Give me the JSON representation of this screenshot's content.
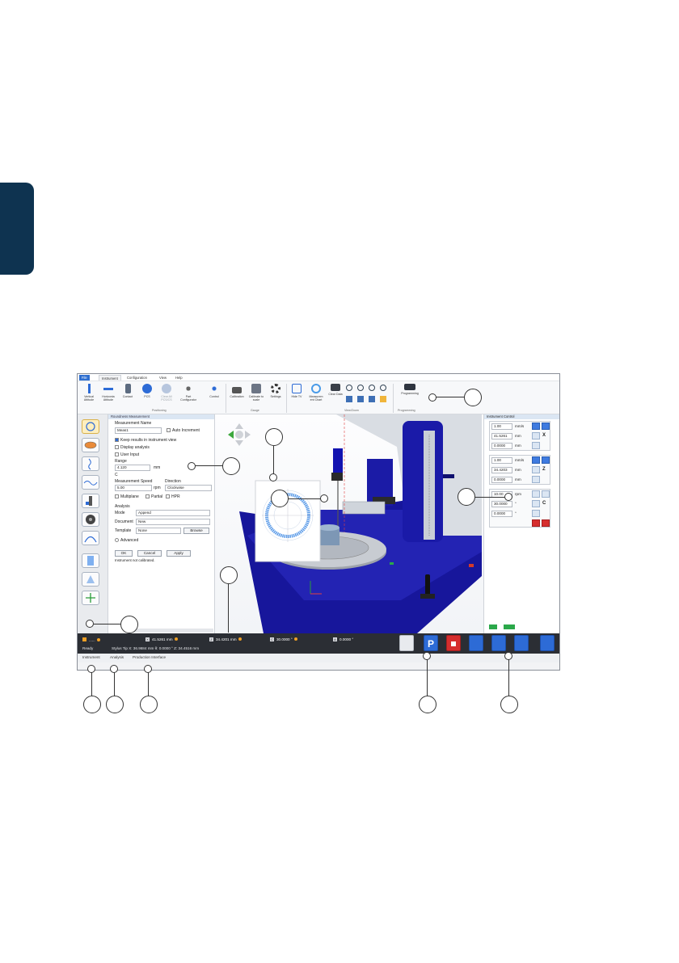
{
  "menu": [
    "File",
    "Instrument",
    "Configuration",
    "View",
    "Help"
  ],
  "ribbon": {
    "buttons": [
      {
        "label": "Vertical Attitude",
        "icon": "vertical-attitude-icon"
      },
      {
        "label": "Horizonta Attitude",
        "icon": "horizontal-attitude-icon"
      },
      {
        "label": "Contact",
        "icon": "contact-icon"
      },
      {
        "label": "PCS",
        "icon": "pcs-icon"
      },
      {
        "label": "Clear All PCS/CS",
        "icon": "clear-pcs-icon"
      },
      {
        "label": "Part Configurator",
        "icon": "part-configurator-icon"
      },
      {
        "label": "Control",
        "icon": "control-icon"
      },
      {
        "label": "Calibration",
        "icon": "calibration-icon"
      },
      {
        "label": "Calibrate to scale",
        "icon": "calibrate-scale-icon"
      },
      {
        "label": "Settings",
        "icon": "settings-gear-icon"
      },
      {
        "label": "Hide TV",
        "icon": "hide-tv-icon"
      },
      {
        "label": "Measurem ent Chart",
        "icon": "measurement-chart-icon"
      },
      {
        "label": "Clear Data",
        "icon": "clear-data-icon"
      },
      {
        "label": "Programming",
        "icon": "programming-icon"
      }
    ],
    "groups": [
      "Positioning",
      "Gauge",
      "View/Zoom",
      "Programming"
    ]
  },
  "panel": {
    "title": "Roundness Measurement",
    "measurement_name_label": "Measurement Name",
    "measurement_name": "Meas1",
    "auto_increment": "Auto Increment",
    "keep_results": "Keep results in instrument view",
    "display_analysis": "Display analysis",
    "user_input": "User Input",
    "range_label": "Range",
    "range_value": "4.120",
    "range_unit": "mm",
    "c_label": "C",
    "speed_label": "Measurement Speed",
    "speed_value": "5.00",
    "speed_unit": "rpm",
    "direction_label": "Direction",
    "direction_value": "Clockwise",
    "multiplane": "Multiplane",
    "partial": "Partial",
    "hpr": "HPR",
    "analysis_label": "Analysis",
    "mode_label": "Mode",
    "mode_value": "Append",
    "document_label": "Document",
    "document_value": "New",
    "template_label": "Template",
    "template_value": "None",
    "browse": "Browse",
    "advanced": "Advanced",
    "ok": "OK",
    "cancel": "Cancel",
    "apply": "Apply",
    "status": "Instrument not calibrated."
  },
  "instrument_control": {
    "title": "Instrument Control",
    "x": {
      "speed": "1.00",
      "speed_unit": "mm/s",
      "pos": "41.5261",
      "pos_unit": "mm",
      "extra": "0.0000",
      "extra_unit": "mm",
      "axis": "X"
    },
    "z": {
      "speed": "1.00",
      "speed_unit": "mm/s",
      "pos": "34.4203",
      "pos_unit": "mm",
      "extra": "0.0000",
      "extra_unit": "mm",
      "axis": "Z"
    },
    "c": {
      "speed": "10.00",
      "speed_unit": "rpm",
      "pos": "30.0000",
      "pos_unit": "°",
      "extra": "0.0000",
      "extra_unit": "°",
      "axis": "C"
    }
  },
  "status": {
    "indicator": "......",
    "x": "41.5261 mm",
    "z": "34.4201 mm",
    "c": "30.0000 °",
    "a": "0.0000 °",
    "ready": "Ready",
    "stylus": "Stylus Tip X: 36.9684 mm θ: 0.0000 °  Z: 34.4516 mm"
  },
  "tabs": [
    "Instrument",
    "Analysis",
    "Production Interface"
  ],
  "colors": {
    "accent": "#2d6bd6",
    "machine": "#1a1aa6",
    "sidetab": "#0e3350",
    "stop": "#d62e2e"
  }
}
